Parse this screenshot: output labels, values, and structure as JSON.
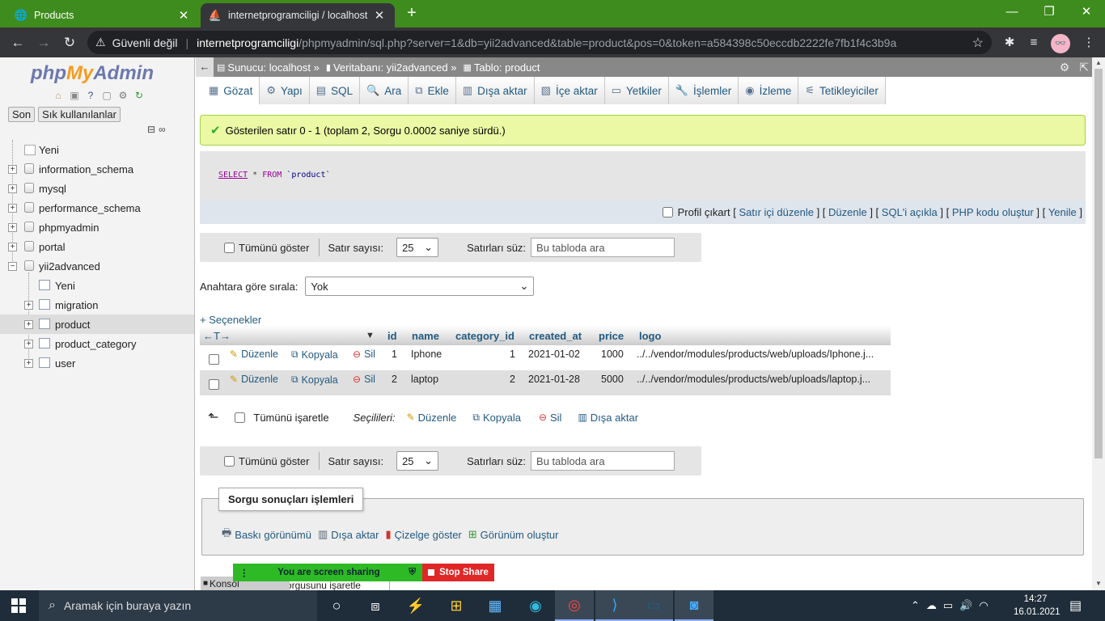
{
  "browser": {
    "tabs": [
      {
        "title": "Products",
        "close": "✕"
      },
      {
        "title": "internetprogramciligi / localhost",
        "close": "✕"
      }
    ],
    "new_tab": "+",
    "window_controls": [
      "—",
      "❐",
      "✕"
    ],
    "security_label": "Güvenli değil",
    "url_host": "internetprogramciligi",
    "url_rest": "/phpmyadmin/sql.php?server=1&db=yii2advanced&table=product&pos=0&token=a584398c50eccdb2222fe7fb1f4c3b9a"
  },
  "sidebar": {
    "logo": {
      "php": "php",
      "my": "My",
      "admin": "Admin"
    },
    "tabs": [
      "Son",
      "Sık kullanılanlar"
    ],
    "tree": [
      {
        "label": "Yeni"
      },
      {
        "label": "information_schema"
      },
      {
        "label": "mysql"
      },
      {
        "label": "performance_schema"
      },
      {
        "label": "phpmyadmin"
      },
      {
        "label": "portal"
      },
      {
        "label": "yii2advanced"
      }
    ],
    "subtree": [
      {
        "label": "Yeni"
      },
      {
        "label": "migration"
      },
      {
        "label": "product"
      },
      {
        "label": "product_category"
      },
      {
        "label": "user"
      }
    ]
  },
  "breadcrumb": {
    "server": "Sunucu: localhost »",
    "database": "Veritabanı: yii2advanced »",
    "table": "Tablo: product"
  },
  "menu": [
    {
      "label": "Gözat",
      "icon": "▦"
    },
    {
      "label": "Yapı",
      "icon": "⚙"
    },
    {
      "label": "SQL",
      "icon": "▤"
    },
    {
      "label": "Ara",
      "icon": "🔍"
    },
    {
      "label": "Ekle",
      "icon": "⧉"
    },
    {
      "label": "Dışa aktar",
      "icon": "▥"
    },
    {
      "label": "İçe aktar",
      "icon": "▧"
    },
    {
      "label": "Yetkiler",
      "icon": "▭"
    },
    {
      "label": "İşlemler",
      "icon": "🔧"
    },
    {
      "label": "İzleme",
      "icon": "◉"
    },
    {
      "label": "Tetikleyiciler",
      "icon": "⚟"
    }
  ],
  "success_message": "Gösterilen satır 0 - 1 (toplam 2, Sorgu 0.0002 saniye sürdü.)",
  "sql": {
    "kw1": "SELECT",
    "mid": " * ",
    "kw2": "FROM",
    "tbl": " `product`"
  },
  "sql_links": {
    "profile": "Profil çıkart",
    "inline_edit": "Satır içi düzenle",
    "edit": "Düzenle",
    "explain": "SQL'i açıkla",
    "php_code": "PHP kodu oluştur",
    "refresh": "Yenile"
  },
  "nav": {
    "show_all": "Tümünü göster",
    "rows_label": "Satır sayısı:",
    "rows_value": "25",
    "filter_label": "Satırları süz:",
    "filter_placeholder": "Bu tabloda ara"
  },
  "sort": {
    "label": "Anahtara göre sırala:",
    "value": "Yok"
  },
  "options_label": "+ Seçenekler",
  "table": {
    "headers": [
      "id",
      "name",
      "category_id",
      "created_at",
      "price",
      "logo"
    ],
    "actions": {
      "edit": "Düzenle",
      "copy": "Kopyala",
      "delete": "Sil"
    },
    "rows": [
      {
        "id": "1",
        "name": "Iphone",
        "category_id": "1",
        "created_at": "2021-01-02",
        "price": "1000",
        "logo": "../../vendor/modules/products/web/uploads/Iphone.j..."
      },
      {
        "id": "2",
        "name": "laptop",
        "category_id": "2",
        "created_at": "2021-01-28",
        "price": "5000",
        "logo": "../../vendor/modules/products/web/uploads/laptop.j..."
      }
    ]
  },
  "bulk": {
    "check_all": "Tümünü işaretle",
    "selected": "Seçilileri:",
    "edit": "Düzenle",
    "copy": "Kopyala",
    "delete": "Sil",
    "export": "Dışa aktar"
  },
  "query_ops": {
    "legend": "Sorgu sonuçları işlemleri",
    "print": "Baskı görünümü",
    "export": "Dışa aktar",
    "chart": "Çizelge göster",
    "view": "Görünüm oluştur"
  },
  "console_label": "Konsol",
  "next_legend": "Bu SQL sorgusunu işaretle",
  "screen_share": {
    "status": "You are screen sharing",
    "stop": "Stop Share"
  },
  "taskbar": {
    "search_placeholder": "Aramak için buraya yazın",
    "time": "14:27",
    "date": "16.01.2021"
  },
  "colors": {
    "chrome_green": "#3f8c1e",
    "link": "#235a81",
    "success_bg": "#ebf8a4"
  }
}
